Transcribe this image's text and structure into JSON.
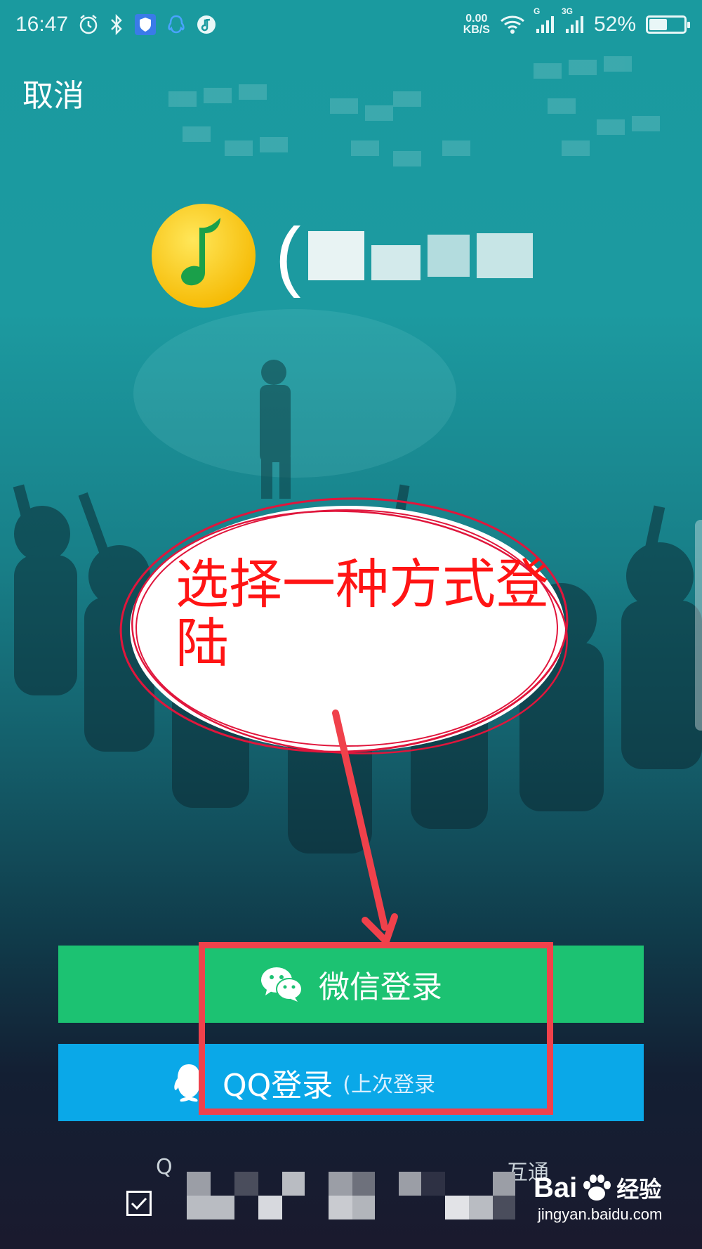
{
  "status_bar": {
    "time": "16:47",
    "net_speed_value": "0.00",
    "net_speed_unit": "KB/S",
    "signal_1_label": "G",
    "signal_2_label": "3G",
    "battery_percent": "52%",
    "battery_level": 0.52
  },
  "header": {
    "cancel_label": "取消"
  },
  "logo": {
    "letter": "("
  },
  "annotation": {
    "text": "选择一种方式登陆"
  },
  "login": {
    "wechat_label": "微信登录",
    "qq_label": "QQ登录",
    "qq_last_login": "(上次登录"
  },
  "footer": {
    "fragment_left": "Q",
    "fragment_right": "互通"
  },
  "watermark": {
    "brand": "Bai",
    "brand_suffix": "经验",
    "url": "jingyan.baidu.com"
  },
  "colors": {
    "wechat_green": "#1cc272",
    "qq_blue": "#0aa8e8",
    "annotation_red": "#ff1414",
    "highlight_red": "#f0414b"
  }
}
